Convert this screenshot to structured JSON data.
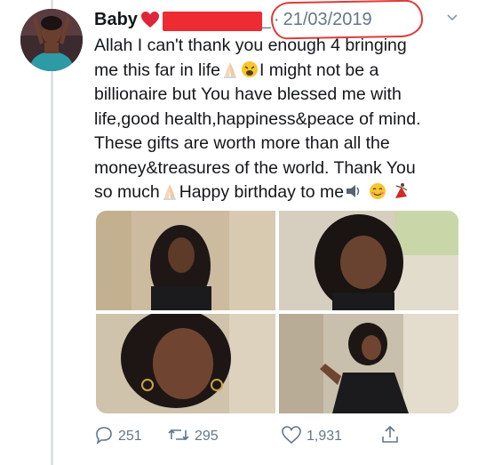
{
  "tweet": {
    "display_name": "Baby",
    "handle": "n_",
    "separator": "·",
    "date": "21/03/2019",
    "lines": [
      [
        "Allah I can't thank you enough 4 bringing"
      ],
      [
        "me this far in life",
        "I might not be a"
      ],
      [
        "billionaire but You have blessed me with"
      ],
      [
        "life,good health,happiness&peace of mind."
      ],
      [
        "These gifts are worth more than all the"
      ],
      [
        "money&treasures of the world. Thank You"
      ],
      [
        "so much",
        "Happy birthday to me"
      ]
    ]
  },
  "actions": {
    "reply_count": "251",
    "retweet_count": "295",
    "like_count": "1,931"
  },
  "icons": {
    "heart_emoji": "red-heart-icon",
    "pray_emoji": "folded-hands-icon",
    "weary_emoji": "weary-face-icon",
    "speaker_emoji": "speaker-icon",
    "relieved_emoji": "relieved-face-icon",
    "dancer_emoji": "dancer-icon",
    "reply": "reply-icon",
    "retweet": "retweet-icon",
    "like": "heart-icon",
    "share": "share-icon",
    "caret": "chevron-down-icon"
  },
  "colors": {
    "text": "#14171a",
    "secondary": "#657786",
    "annotation": "#e03a3a",
    "redaction": "#ee2a33"
  }
}
